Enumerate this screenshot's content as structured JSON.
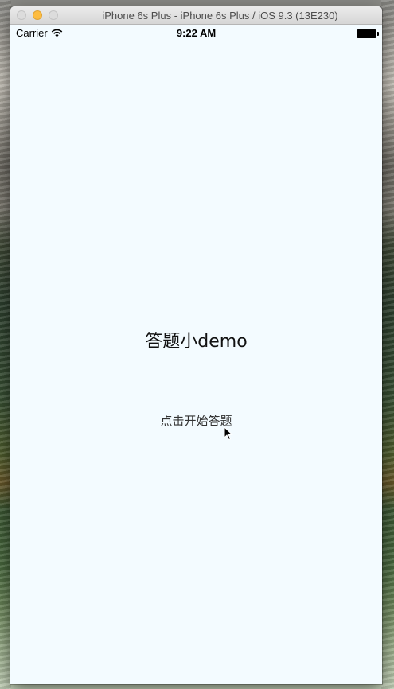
{
  "simulator": {
    "window_title": "iPhone 6s Plus - iPhone 6s Plus / iOS 9.3 (13E230)"
  },
  "status_bar": {
    "carrier": "Carrier",
    "time": "9:22 AM",
    "icons": [
      "wifi-icon",
      "battery-icon"
    ]
  },
  "app": {
    "title": "答题小demo",
    "start_button_label": "点击开始答题"
  },
  "colors": {
    "screen_background": "#f3fbff",
    "text_primary": "#111111",
    "button_text": "#333333",
    "minimize_light": "#fdbc40"
  }
}
